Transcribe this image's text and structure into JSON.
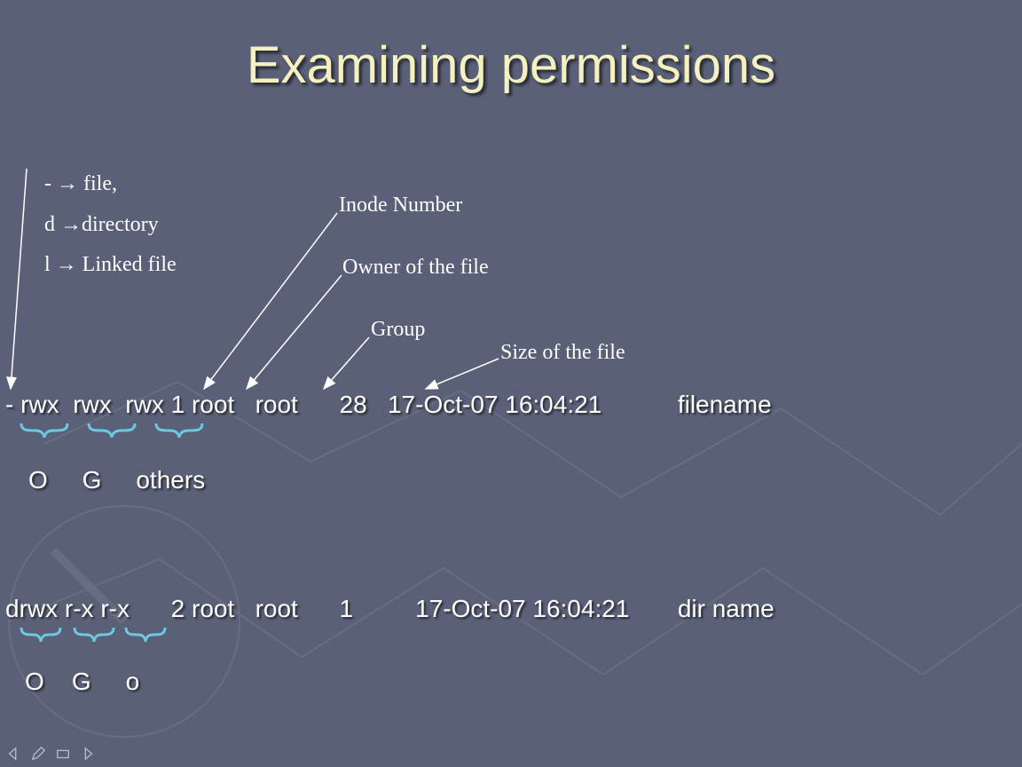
{
  "title": "Examining permissions",
  "legend": {
    "line1_a": "- ",
    "line1_b": " file,",
    "line2_a": "d ",
    "line2_b": "directory",
    "line3_a": "l ",
    "line3_b": " Linked file",
    "arrow_glyph": "→"
  },
  "labels": {
    "inode": "Inode Number",
    "owner": "Owner of the file",
    "group": "Group",
    "size": "Size of the file"
  },
  "line1": "- rwx  rwx  rwx 1 root   root      28   17-Oct-07 16:04:21           filename",
  "line1_brace_labels": "O     G     others",
  "line2": "drwx r-x r-x      2 root   root      1         17-Oct-07 16:04:21       dir name",
  "line2_brace_labels": "O    G     o",
  "nav": {
    "prev": "prev",
    "pen": "pen",
    "menu": "menu",
    "next": "next"
  }
}
